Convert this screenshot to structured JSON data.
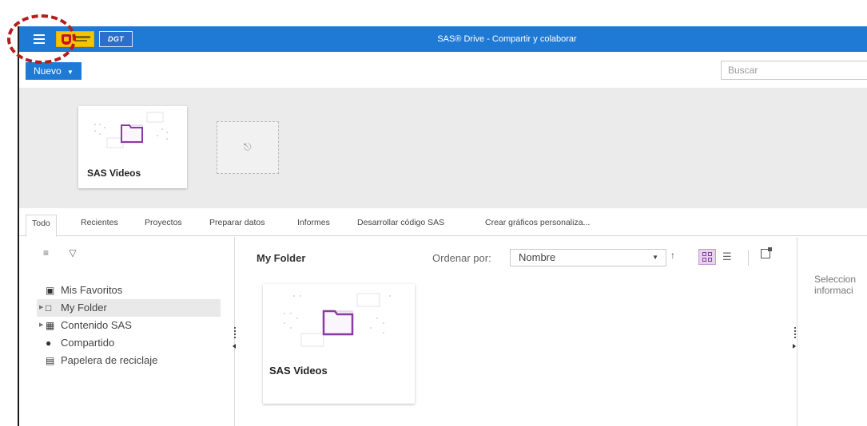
{
  "header": {
    "title": "SAS® Drive - Compartir y colaborar",
    "logo_dgt": "DGT"
  },
  "toolbar": {
    "new_label": "Nuevo",
    "new_caret": "▼",
    "search_placeholder": "Buscar"
  },
  "quick_access": {
    "cards": [
      {
        "label": "SAS Videos"
      }
    ],
    "add_icon": "add-lightbulb-icon"
  },
  "tabs": [
    {
      "label": "Todo",
      "active": true
    },
    {
      "label": "Recientes"
    },
    {
      "label": "Proyectos"
    },
    {
      "label": "Preparar datos"
    },
    {
      "label": "Informes"
    },
    {
      "label": "Desarrollar código SAS"
    },
    {
      "label": "Crear gráficos personaliza..."
    }
  ],
  "navigation": {
    "tools": [
      "tree-view-icon",
      "filter-icon"
    ],
    "items": [
      {
        "label": "Mis Favoritos",
        "icon": "favorites-folder-icon",
        "expandable": false
      },
      {
        "label": "My Folder",
        "icon": "folder-icon",
        "expandable": true,
        "selected": true
      },
      {
        "label": "Contenido SAS",
        "icon": "content-folder-icon",
        "expandable": true
      },
      {
        "label": "Compartido",
        "icon": "shared-users-icon",
        "expandable": false
      },
      {
        "label": "Papelera de reciclaje",
        "icon": "trash-icon",
        "expandable": false
      }
    ]
  },
  "main": {
    "title": "My Folder",
    "sort_label": "Ordenar por:",
    "sort_value": "Nombre",
    "sort_direction": "↑",
    "items": [
      {
        "label": "SAS Videos"
      }
    ]
  },
  "details": {
    "hint": "Seleccion",
    "hint2": "informaci"
  },
  "colors": {
    "topbar": "#1f7ad6",
    "accent_purple": "#8b3aa4",
    "annotation": "#b51c1c"
  }
}
